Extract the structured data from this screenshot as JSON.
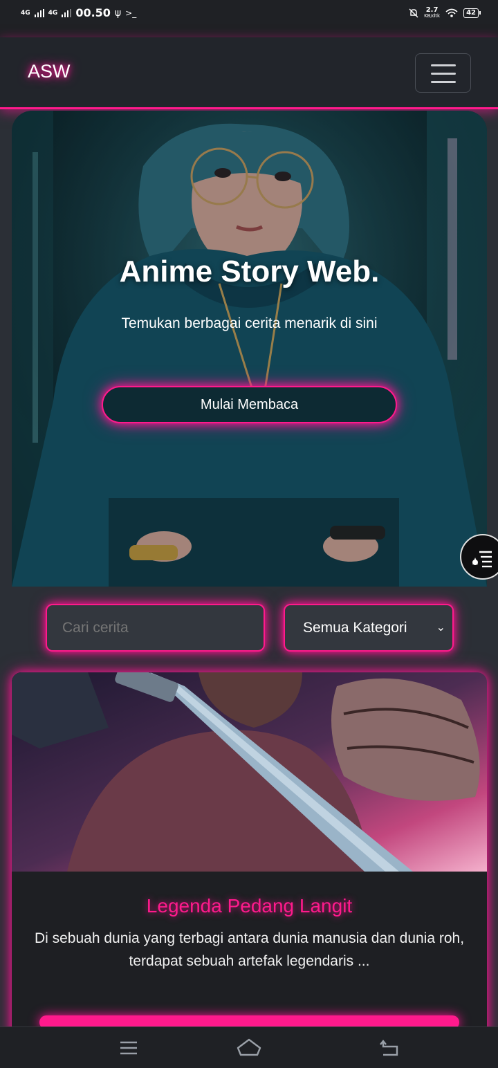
{
  "status_bar": {
    "network_1": "4G",
    "network_2": "4G",
    "time": "00.50",
    "speed": "2.7",
    "speed_unit": "KB/dtk",
    "battery": "42"
  },
  "navbar": {
    "brand": "ASW",
    "menu_icon": "hamburger-icon"
  },
  "hero": {
    "title": "Anime Story Web.",
    "subtitle": "Temukan berbagai cerita menarik di sini",
    "cta_label": "Mulai Membaca"
  },
  "filters": {
    "search_placeholder": "Cari cerita",
    "category_selected": "Semua Kategori"
  },
  "stories": [
    {
      "title": "Legenda Pedang Langit",
      "excerpt": "Di sebuah dunia yang terbagi antara dunia manusia dan dunia roh, terdapat sebuah artefak legendaris ..."
    }
  ],
  "colors": {
    "accent": "#ff1a8c",
    "background": "#2b2f36",
    "navbar": "#22252b"
  },
  "icons": {
    "usb": "usb-icon",
    "terminal": "terminal-icon",
    "mute": "mute-icon",
    "wifi": "wifi-icon",
    "float": "reader-menu-icon",
    "nav_recent": "menu-lines-icon",
    "nav_home": "home-icon",
    "nav_back": "back-icon"
  }
}
